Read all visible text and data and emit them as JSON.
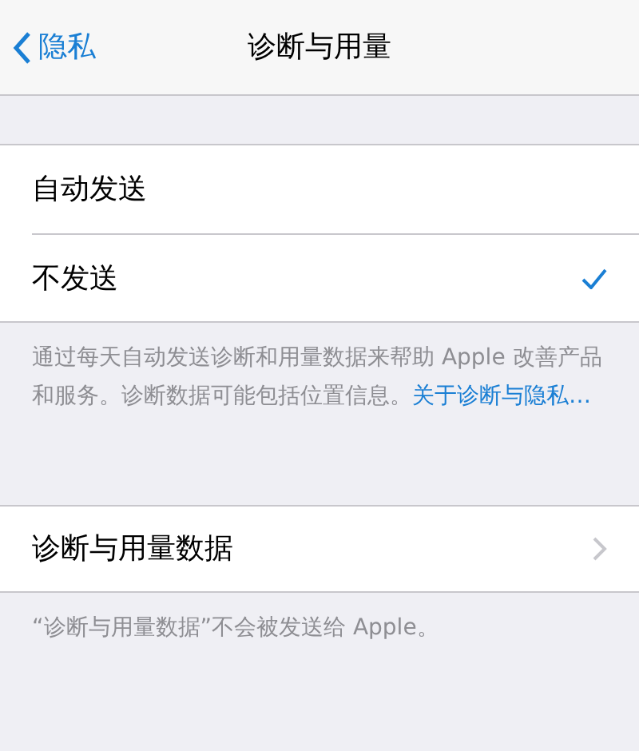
{
  "nav": {
    "back": "隐私",
    "title": "诊断与用量"
  },
  "options": [
    {
      "label": "自动发送",
      "selected": false
    },
    {
      "label": "不发送",
      "selected": true
    }
  ],
  "options_footer": {
    "text": "通过每天自动发送诊断和用量数据来帮助 Apple 改善产品和服务。诊断数据可能包括位置信息。",
    "link": "关于诊断与隐私…"
  },
  "data_row": {
    "label": "诊断与用量数据"
  },
  "data_footer": "“诊断与用量数据”不会被发送给 Apple。"
}
